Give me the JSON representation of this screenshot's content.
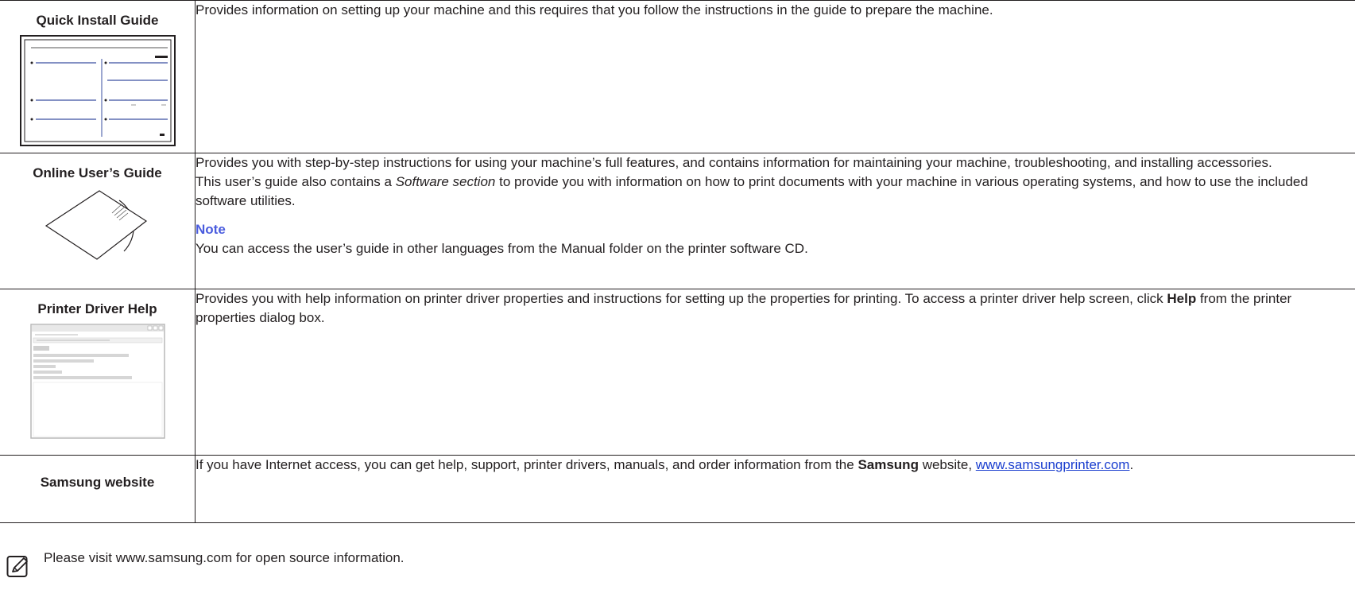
{
  "rows": [
    {
      "title": "Quick Install Guide",
      "description": "Provides information on setting up your machine and this requires that you follow the instructions in the guide to prepare the machine.",
      "thumb_icon": "quick-install-guide-thumbnail"
    },
    {
      "title": "Online User’s Guide",
      "desc_line1": "Provides you with step-by-step instructions for using your machine’s full features, and contains information for maintaining your machine, troubleshooting, and installing accessories.",
      "desc_line2_before": "This user’s guide also contains a ",
      "desc_line2_italic": "Software section",
      "desc_line2_after": " to provide you with information on how to print documents with your machine in various operating systems, and how to use the included software utilities.",
      "note_heading": "Note",
      "note_text": "You can access the user’s guide in other languages from the Manual folder on the printer software CD.",
      "thumb_icon": "cd-icon"
    },
    {
      "title": "Printer Driver Help",
      "desc_before": "Provides you with help information on printer driver properties and instructions for setting up the properties for printing. To access a printer driver help screen, click ",
      "desc_bold": "Help",
      "desc_after": " from the printer properties dialog box.",
      "thumb_icon": "help-window-thumbnail"
    },
    {
      "title": "Samsung website",
      "desc_before": "If you have Internet access, you can get help, support, printer drivers, manuals, and order information from the ",
      "desc_bold": "Samsung",
      "desc_middle": " website, ",
      "link_text": "www.samsungprinter.com",
      "desc_after": "."
    }
  ],
  "footer": {
    "text": "Please visit www.samsung.com for open source information.",
    "icon": "note-pencil-icon"
  },
  "colors": {
    "text": "#231f20",
    "note_heading": "#4a5cde",
    "link": "#1a3ecf"
  }
}
